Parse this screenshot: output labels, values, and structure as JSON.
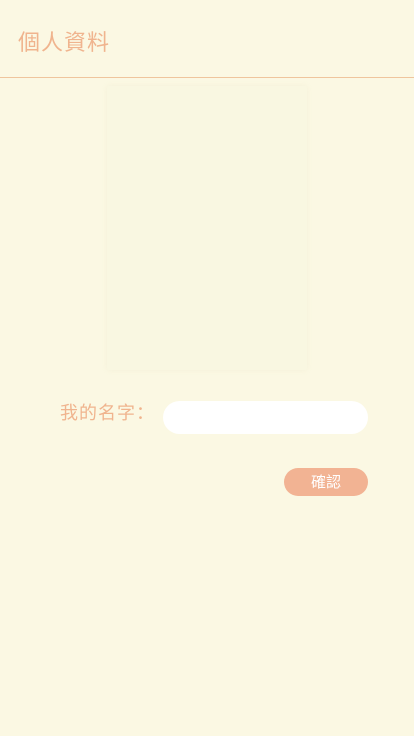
{
  "header": {
    "title": "個人資料"
  },
  "profile": {
    "name_label": "我的名字：",
    "name_value": "",
    "confirm_label": "確認"
  },
  "colors": {
    "background": "#fbf8e3",
    "accent": "#f0b48e",
    "button": "#f2b393",
    "divider": "#efc59d"
  }
}
